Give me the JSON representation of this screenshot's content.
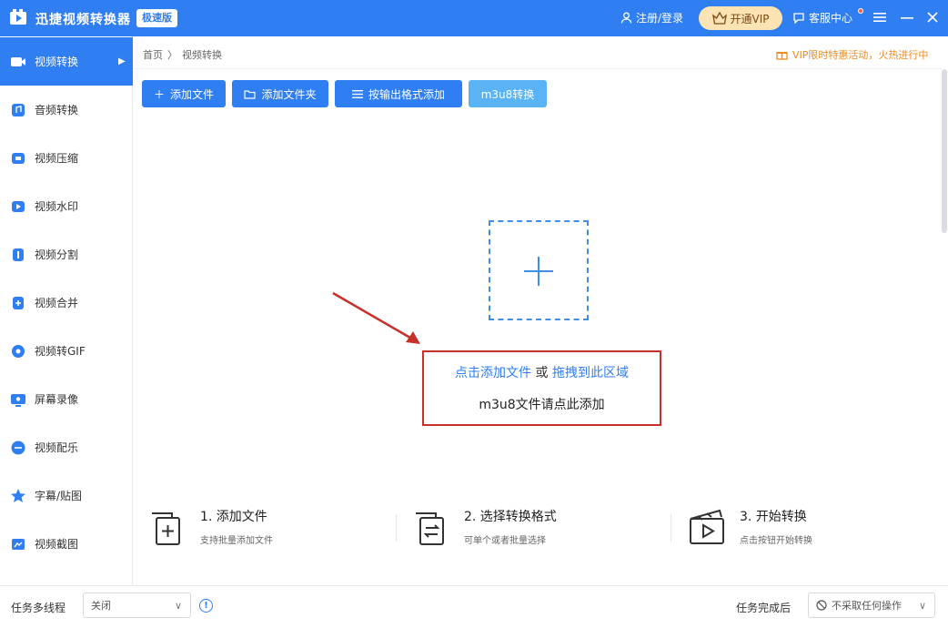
{
  "titlebar": {
    "app_title": "迅捷视频转换器",
    "edition": "极速版",
    "login": "注册/登录",
    "vip": "开通VIP",
    "service": "客服中心"
  },
  "sidebar": {
    "items": [
      {
        "label": "视频转换",
        "icon": "video-convert-icon",
        "active": true
      },
      {
        "label": "音频转换",
        "icon": "audio-convert-icon"
      },
      {
        "label": "视频压缩",
        "icon": "video-compress-icon"
      },
      {
        "label": "视频水印",
        "icon": "video-watermark-icon"
      },
      {
        "label": "视频分割",
        "icon": "video-split-icon"
      },
      {
        "label": "视频合并",
        "icon": "video-merge-icon"
      },
      {
        "label": "视频转GIF",
        "icon": "gif-icon"
      },
      {
        "label": "屏幕录像",
        "icon": "screen-record-icon"
      },
      {
        "label": "视频配乐",
        "icon": "music-icon"
      },
      {
        "label": "字幕/贴图",
        "icon": "subtitle-icon"
      },
      {
        "label": "视频截图",
        "icon": "screenshot-icon"
      }
    ]
  },
  "breadcrumb": {
    "home": "首页",
    "sep": "〉",
    "current": "视频转换"
  },
  "promo": {
    "text": "VIP限时特惠活动，火热进行中"
  },
  "toolbar": {
    "add_file": "添加文件",
    "add_folder": "添加文件夹",
    "add_by_format": "按输出格式添加",
    "m3u8": "m3u8转换"
  },
  "dropzone": {
    "click_add": "点击添加文件",
    "or": " 或 ",
    "drag_here": "拖拽到此区域",
    "m3u8_hint": "m3u8文件请点此添加"
  },
  "steps": [
    {
      "title": "1. 添加文件",
      "desc": "支持批量添加文件"
    },
    {
      "title": "2. 选择转换格式",
      "desc": "可单个或者批量选择"
    },
    {
      "title": "3. 开始转换",
      "desc": "点击按钮开始转换"
    }
  ],
  "bottom": {
    "multithread_label": "任务多线程",
    "multithread_value": "关闭",
    "after_complete_label": "任务完成后",
    "after_complete_value": "不采取任何操作"
  },
  "colors": {
    "primary": "#2f7ef2",
    "light_button": "#5ab3f5",
    "highlight_red": "#c8302a",
    "vip_bg": "#fbe3b4"
  }
}
